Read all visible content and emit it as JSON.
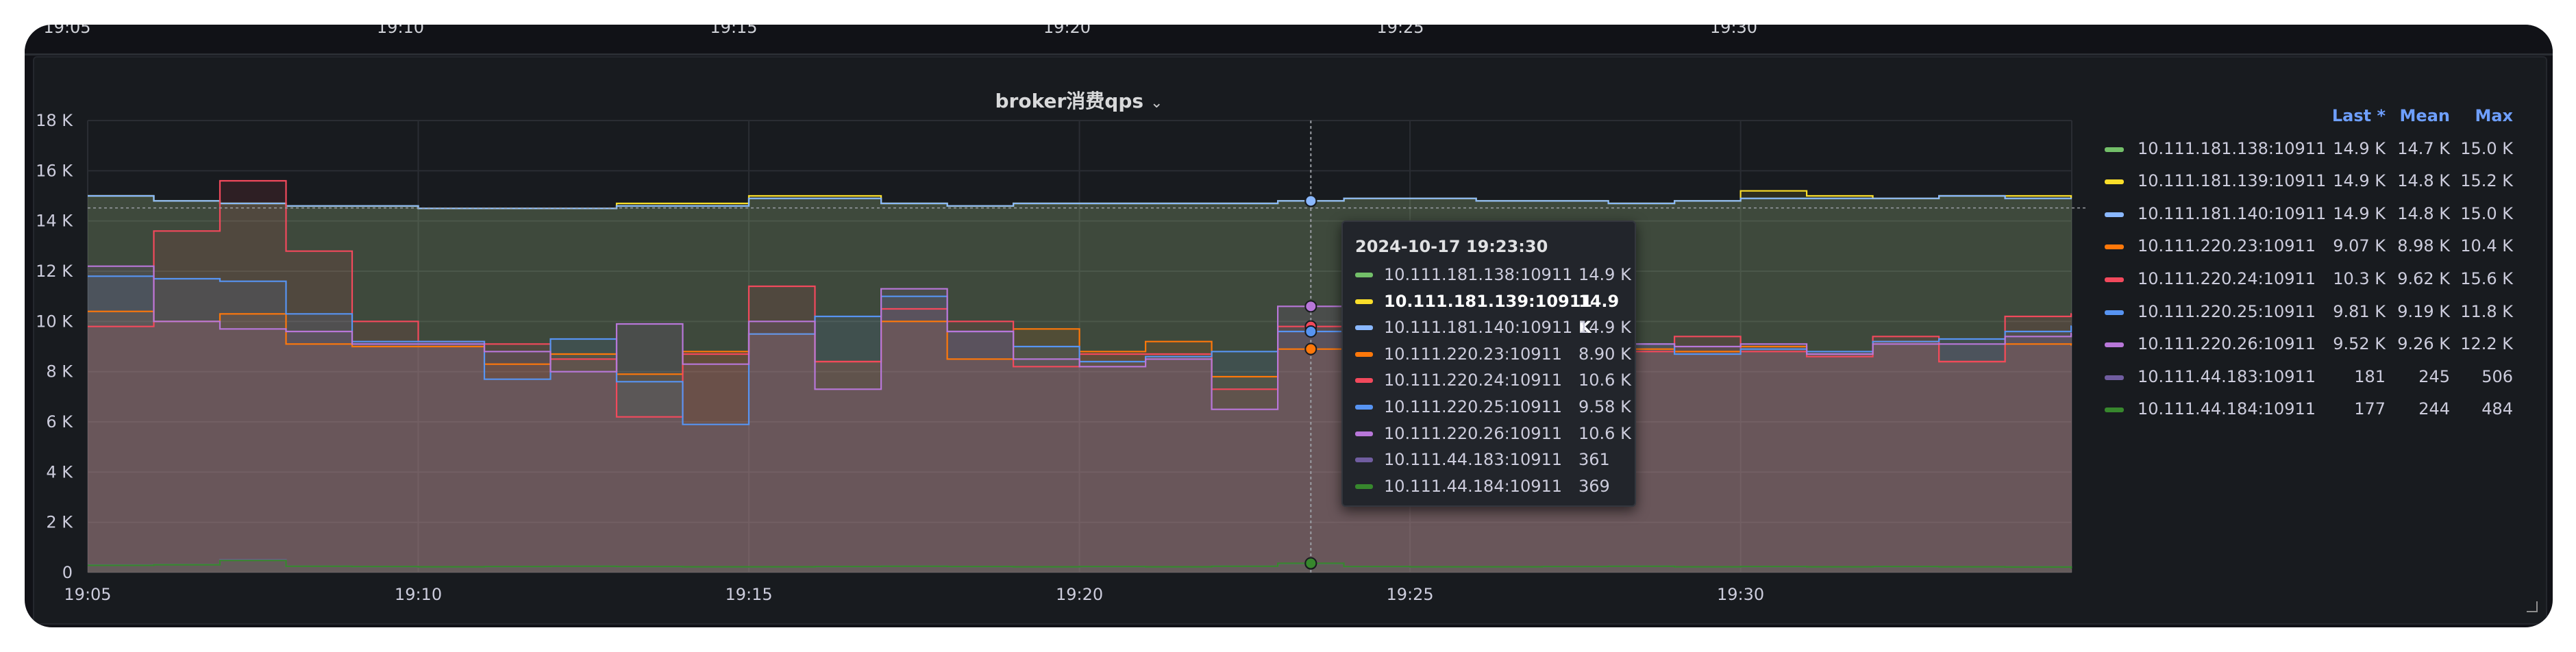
{
  "top_strip": {
    "tick_labels": [
      "19:05",
      "19:10",
      "19:15",
      "19:20",
      "19:25",
      "19:30"
    ]
  },
  "panel": {
    "title": "broker消费qps",
    "menu_icon": "chevron-down-icon"
  },
  "legend": {
    "headers": {
      "last": "Last *",
      "mean": "Mean",
      "max": "Max"
    },
    "items": [
      {
        "name": "10.111.181.138:10911",
        "last": "14.9 K",
        "mean": "14.7 K",
        "max": "15.0 K",
        "color": "#73bf69"
      },
      {
        "name": "10.111.181.139:10911",
        "last": "14.9 K",
        "mean": "14.8 K",
        "max": "15.2 K",
        "color": "#fade2a"
      },
      {
        "name": "10.111.181.140:10911",
        "last": "14.9 K",
        "mean": "14.8 K",
        "max": "15.0 K",
        "color": "#8ab8ff"
      },
      {
        "name": "10.111.220.23:10911",
        "last": "9.07 K",
        "mean": "8.98 K",
        "max": "10.4 K",
        "color": "#ff780a"
      },
      {
        "name": "10.111.220.24:10911",
        "last": "10.3 K",
        "mean": "9.62 K",
        "max": "15.6 K",
        "color": "#f2495c"
      },
      {
        "name": "10.111.220.25:10911",
        "last": "9.81 K",
        "mean": "9.19 K",
        "max": "11.8 K",
        "color": "#5794f2"
      },
      {
        "name": "10.111.220.26:10911",
        "last": "9.52 K",
        "mean": "9.26 K",
        "max": "12.2 K",
        "color": "#b877d9"
      },
      {
        "name": "10.111.44.183:10911",
        "last": "181",
        "mean": "245",
        "max": "506",
        "color": "#705da0"
      },
      {
        "name": "10.111.44.184:10911",
        "last": "177",
        "mean": "244",
        "max": "484",
        "color": "#37872d"
      }
    ]
  },
  "tooltip": {
    "time": "2024-10-17 19:23:30",
    "rows": [
      {
        "name": "10.111.181.138:10911",
        "value": "14.9 K",
        "color": "#73bf69",
        "bold": false
      },
      {
        "name": "10.111.181.139:10911",
        "value": "14.9 K",
        "color": "#fade2a",
        "bold": true
      },
      {
        "name": "10.111.181.140:10911",
        "value": "14.9 K",
        "color": "#8ab8ff",
        "bold": false
      },
      {
        "name": "10.111.220.23:10911",
        "value": "8.90 K",
        "color": "#ff780a",
        "bold": false
      },
      {
        "name": "10.111.220.24:10911",
        "value": "10.6 K",
        "color": "#f2495c",
        "bold": false
      },
      {
        "name": "10.111.220.25:10911",
        "value": "9.58 K",
        "color": "#5794f2",
        "bold": false
      },
      {
        "name": "10.111.220.26:10911",
        "value": "10.6 K",
        "color": "#b877d9",
        "bold": false
      },
      {
        "name": "10.111.44.183:10911",
        "value": "361",
        "color": "#705da0",
        "bold": false
      },
      {
        "name": "10.111.44.184:10911",
        "value": "369",
        "color": "#37872d",
        "bold": false
      }
    ]
  },
  "chart_data": {
    "type": "area",
    "title": "broker消费qps",
    "xlabel": "",
    "ylabel": "",
    "x_ticks": [
      "19:05",
      "19:10",
      "19:15",
      "19:20",
      "19:25",
      "19:30"
    ],
    "y_ticks": [
      "0",
      "2 K",
      "4 K",
      "6 K",
      "8 K",
      "10 K",
      "12 K",
      "14 K",
      "16 K",
      "18 K"
    ],
    "ylim": [
      0,
      18000
    ],
    "grid": true,
    "legend_position": "right",
    "hover_time": "19:23:30",
    "x": [
      "19:05",
      "19:06",
      "19:07",
      "19:08",
      "19:09",
      "19:10",
      "19:11",
      "19:12",
      "19:13",
      "19:14",
      "19:15",
      "19:16",
      "19:17",
      "19:18",
      "19:19",
      "19:20",
      "19:21",
      "19:22",
      "19:23",
      "19:24",
      "19:25",
      "19:26",
      "19:27",
      "19:28",
      "19:29",
      "19:30",
      "19:31",
      "19:32",
      "19:33",
      "19:34",
      "19:35"
    ],
    "series": [
      {
        "name": "10.111.181.138:10911",
        "color": "#73bf69",
        "values": [
          15000,
          14800,
          14700,
          14600,
          14600,
          14500,
          14500,
          14500,
          14600,
          14600,
          14900,
          14900,
          14700,
          14600,
          14700,
          14700,
          14700,
          14700,
          14800,
          14900,
          14900,
          14800,
          14800,
          14700,
          14800,
          14900,
          14900,
          14900,
          15000,
          14900,
          14900
        ]
      },
      {
        "name": "10.111.181.139:10911",
        "color": "#fade2a",
        "values": [
          15000,
          14800,
          14700,
          14600,
          14600,
          14500,
          14500,
          14500,
          14700,
          14700,
          15000,
          15000,
          14700,
          14600,
          14700,
          14700,
          14700,
          14700,
          14800,
          14900,
          14900,
          14800,
          14800,
          14700,
          14800,
          15200,
          15000,
          14900,
          15000,
          15000,
          14900
        ]
      },
      {
        "name": "10.111.181.140:10911",
        "color": "#8ab8ff",
        "values": [
          15000,
          14800,
          14700,
          14600,
          14600,
          14500,
          14500,
          14500,
          14600,
          14600,
          14900,
          14900,
          14700,
          14600,
          14700,
          14700,
          14700,
          14700,
          14800,
          14900,
          14900,
          14800,
          14800,
          14700,
          14800,
          14900,
          14900,
          14900,
          15000,
          14900,
          14900
        ]
      },
      {
        "name": "10.111.220.23:10911",
        "color": "#ff780a",
        "values": [
          10400,
          10000,
          10300,
          9100,
          9000,
          9000,
          8300,
          8700,
          7900,
          8800,
          9500,
          8400,
          10000,
          8500,
          9700,
          8800,
          9200,
          7800,
          8900,
          9200,
          9000,
          9000,
          9000,
          8900,
          8800,
          9000,
          8700,
          9200,
          8400,
          9100,
          9070
        ]
      },
      {
        "name": "10.111.220.24:10911",
        "color": "#f2495c",
        "values": [
          9800,
          13600,
          15600,
          12800,
          10000,
          9200,
          9100,
          8500,
          6200,
          8700,
          11400,
          8400,
          10500,
          10000,
          8200,
          8700,
          8700,
          7300,
          9800,
          9200,
          8900,
          9000,
          9000,
          8800,
          9400,
          8800,
          8600,
          9400,
          8400,
          10200,
          10300
        ]
      },
      {
        "name": "10.111.220.25:10911",
        "color": "#5794f2",
        "values": [
          11800,
          11700,
          11600,
          10300,
          9200,
          9200,
          7700,
          9300,
          7600,
          5900,
          9500,
          10200,
          11000,
          9600,
          9000,
          8400,
          8600,
          8800,
          9600,
          9400,
          9300,
          9300,
          9100,
          9100,
          8700,
          8900,
          8800,
          9200,
          9300,
          9600,
          9810
        ]
      },
      {
        "name": "10.111.220.26:10911",
        "color": "#b877d9",
        "values": [
          12200,
          10000,
          9700,
          9600,
          9100,
          9100,
          8800,
          8000,
          9900,
          8300,
          10000,
          7300,
          11300,
          9600,
          8500,
          8200,
          8500,
          6500,
          10600,
          9300,
          9100,
          9100,
          9200,
          9100,
          9000,
          9100,
          8700,
          9100,
          9100,
          9400,
          9520
        ]
      },
      {
        "name": "10.111.44.183:10911",
        "color": "#705da0",
        "values": [
          300,
          320,
          506,
          250,
          240,
          230,
          240,
          250,
          240,
          230,
          230,
          240,
          250,
          240,
          230,
          240,
          230,
          250,
          361,
          240,
          230,
          230,
          240,
          250,
          230,
          240,
          230,
          240,
          230,
          220,
          181
        ]
      },
      {
        "name": "10.111.44.184:10911",
        "color": "#37872d",
        "values": [
          290,
          310,
          484,
          250,
          240,
          230,
          240,
          250,
          240,
          230,
          230,
          240,
          250,
          240,
          230,
          240,
          230,
          250,
          369,
          240,
          230,
          230,
          240,
          250,
          230,
          240,
          230,
          240,
          230,
          220,
          177
        ]
      }
    ]
  }
}
